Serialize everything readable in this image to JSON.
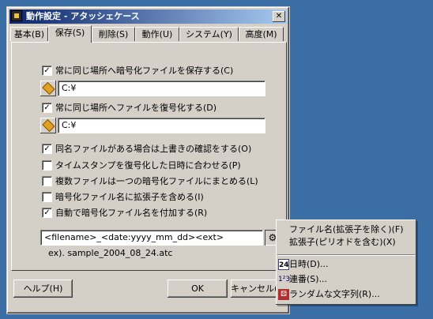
{
  "window": {
    "title": "動作設定 - アタッシェケース",
    "close": "✕"
  },
  "tabs": [
    {
      "label": "基本(B)"
    },
    {
      "label": "保存(S)"
    },
    {
      "label": "削除(S)"
    },
    {
      "label": "動作(U)"
    },
    {
      "label": "システム(Y)"
    },
    {
      "label": "高度(M)"
    }
  ],
  "options": {
    "save_same_place": {
      "label": "常に同じ場所へ暗号化ファイルを保存する(C)",
      "checked": true,
      "path": "C:¥"
    },
    "decrypt_same_place": {
      "label": "常に同じ場所へファイルを復号化する(D)",
      "checked": true,
      "path": "C:¥"
    },
    "confirm_overwrite": {
      "label": "同名ファイルがある場合は上書きの確認をする(O)",
      "checked": true
    },
    "match_timestamp": {
      "label": "タイムスタンプを復号化した日時に合わせる(P)",
      "checked": false
    },
    "combine_files": {
      "label": "複数ファイルは一つの暗号化ファイルにまとめる(L)",
      "checked": false
    },
    "include_ext": {
      "label": "暗号化ファイル名に拡張子を含める(I)",
      "checked": false
    },
    "auto_name": {
      "label": "自動で暗号化ファイル名を付加する(R)",
      "checked": true
    }
  },
  "filename_format": "<filename>_<date:yyyy_mm_dd><ext>",
  "example": "ex). sample_2004_08_24.atc",
  "buttons": {
    "help": "ヘルプ(H)",
    "ok": "OK",
    "cancel": "キャンセル(C)"
  },
  "menu": {
    "items": [
      {
        "label": "ファイル名(拡張子を除く)(F)",
        "icon": ""
      },
      {
        "label": "拡張子(ピリオドを含む)(X)",
        "icon": ""
      },
      {
        "label": "日時(D)...",
        "icon": "calendar-icon"
      },
      {
        "label": "連番(S)...",
        "icon": "sequence-icon"
      },
      {
        "label": "ランダムな文字列(R)...",
        "icon": "random-icon"
      }
    ]
  }
}
